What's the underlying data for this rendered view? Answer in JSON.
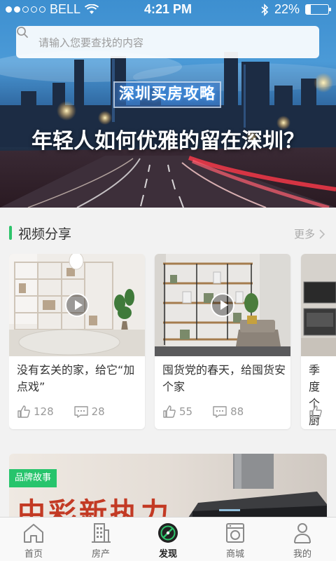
{
  "status_bar": {
    "carrier": "BELL",
    "time": "4:21 PM",
    "battery": "22%",
    "battery_level": 0.22,
    "signal_bars_filled": 2
  },
  "search": {
    "placeholder": "请输入您要查找的内容"
  },
  "banner": {
    "tag": "深圳买房攻略",
    "headline": "年轻人如何优雅的留在深圳？"
  },
  "video_section": {
    "title": "视频分享",
    "more_label": "更多",
    "cards": [
      {
        "title": "没有玄关的家，给它“加点戏”",
        "likes": "128",
        "comments": "28",
        "has_play": true
      },
      {
        "title": "囤货党的春天，给囤货安个家",
        "likes": "55",
        "comments": "88",
        "has_play": true
      },
      {
        "title": "季度个厨",
        "likes": "",
        "comments": "",
        "has_play": false
      }
    ]
  },
  "brand_story": {
    "tag": "品牌故事",
    "slogan": "中彩新执力"
  },
  "tabbar": {
    "items": [
      {
        "label": "首页",
        "icon": "home-icon",
        "active": false
      },
      {
        "label": "房产",
        "icon": "building-icon",
        "active": false
      },
      {
        "label": "发现",
        "icon": "compass-icon",
        "active": true
      },
      {
        "label": "商城",
        "icon": "washer-icon",
        "active": false
      },
      {
        "label": "我的",
        "icon": "user-icon",
        "active": false
      }
    ]
  },
  "colors": {
    "accent": "#2ec46b",
    "brand_tag": "#27c46c",
    "slogan_red": "#c33a24"
  }
}
